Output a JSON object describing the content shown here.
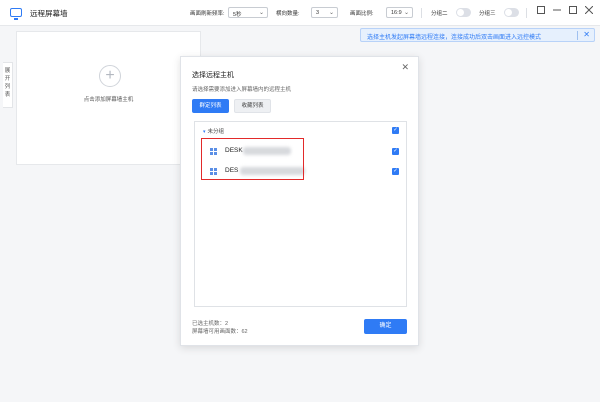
{
  "app": {
    "title": "远程屏幕墙"
  },
  "toolbar": {
    "refresh_label": "画面刷新频率:",
    "refresh_value": "5秒",
    "horizontal_label": "横向数量:",
    "horizontal_value": "3",
    "ratio_label": "画面比例:",
    "ratio_value": "16:9",
    "group2_label": "分组二",
    "group3_label": "分组三"
  },
  "sidebar_tab": {
    "label": "展开列表"
  },
  "add_panel": {
    "add_text": "点击添加屏幕墙主机"
  },
  "banner": {
    "text": "选择主机发起屏幕墙远程连接，连接成功后双击画面进入远控模式"
  },
  "dialog": {
    "title": "选择远程主机",
    "description": "请选择需要添加进入屏幕墙内的远程主机",
    "tabs": [
      {
        "label": "群定列表",
        "active": true
      },
      {
        "label": "收藏列表",
        "active": false
      }
    ],
    "group": {
      "label": "未分组",
      "checked": true
    },
    "hosts": [
      {
        "name": "DESK",
        "checked": true
      },
      {
        "name": "DES",
        "checked": true
      }
    ],
    "selected_label": "已选主机数：2",
    "available_label": "屏幕墙可用画面数：62",
    "confirm_label": "确定"
  },
  "colors": {
    "accent": "#2f7bf5",
    "highlight": "#e22a2a"
  }
}
